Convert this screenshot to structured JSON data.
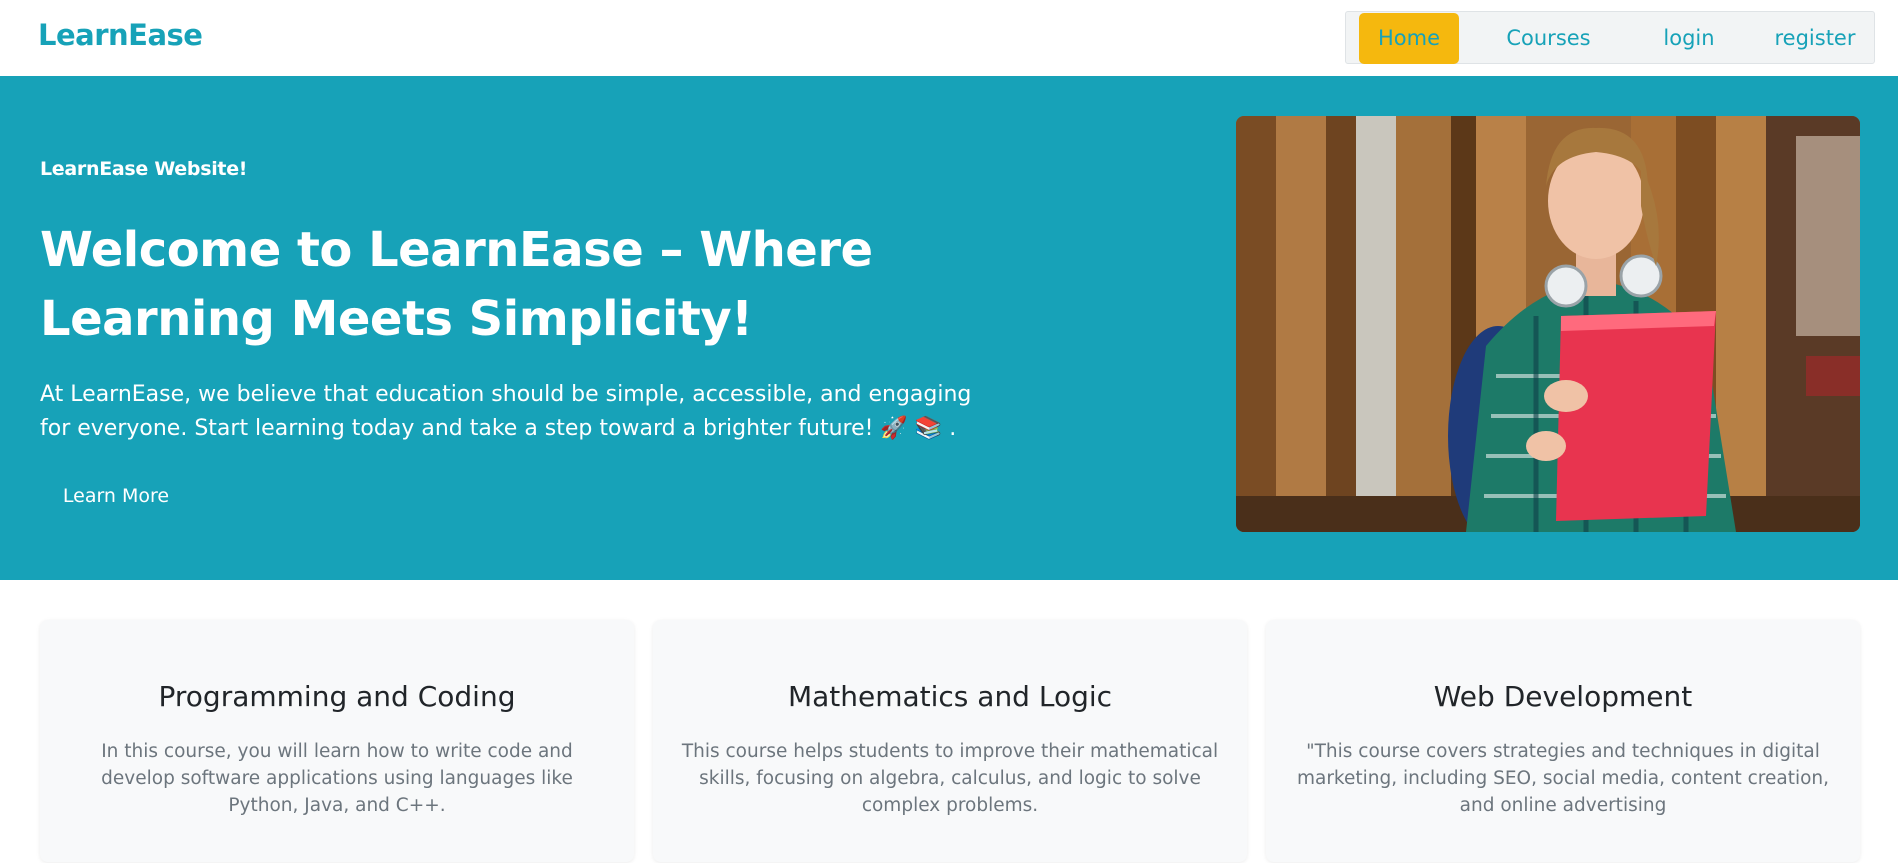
{
  "navbar": {
    "brand": "LearnEase",
    "links": [
      {
        "label": "Home",
        "active": true
      },
      {
        "label": "Courses"
      },
      {
        "label": "login"
      },
      {
        "label": "register"
      }
    ]
  },
  "hero": {
    "tagline": "LearnEase Website!",
    "title": "Welcome to LearnEase – Where Learning Meets Simplicity!",
    "description": "At LearnEase, we believe that education should be simple, accessible, and engaging for everyone. Start learning today and take a step toward a brighter future! 🚀 📚 .",
    "button_label": "Learn More",
    "image_alt": "Student holding a red folder with headphones around her neck"
  },
  "courses": [
    {
      "title": "Programming and Coding",
      "description": "In this course, you will learn how to write code and develop software applications using languages like Python, Java, and C++."
    },
    {
      "title": "Mathematics and Logic",
      "description": "This course helps students to improve their mathematical skills, focusing on algebra, calculus, and logic to solve complex problems."
    },
    {
      "title": "Web Development",
      "description": "\"This course covers strategies and techniques in digital marketing, including SEO, social media, content creation, and online advertising"
    }
  ],
  "colors": {
    "primary": "#17a2b8",
    "accent": "#f5b80e",
    "card_bg": "#f8f9fa",
    "muted_text": "#6c757d"
  }
}
